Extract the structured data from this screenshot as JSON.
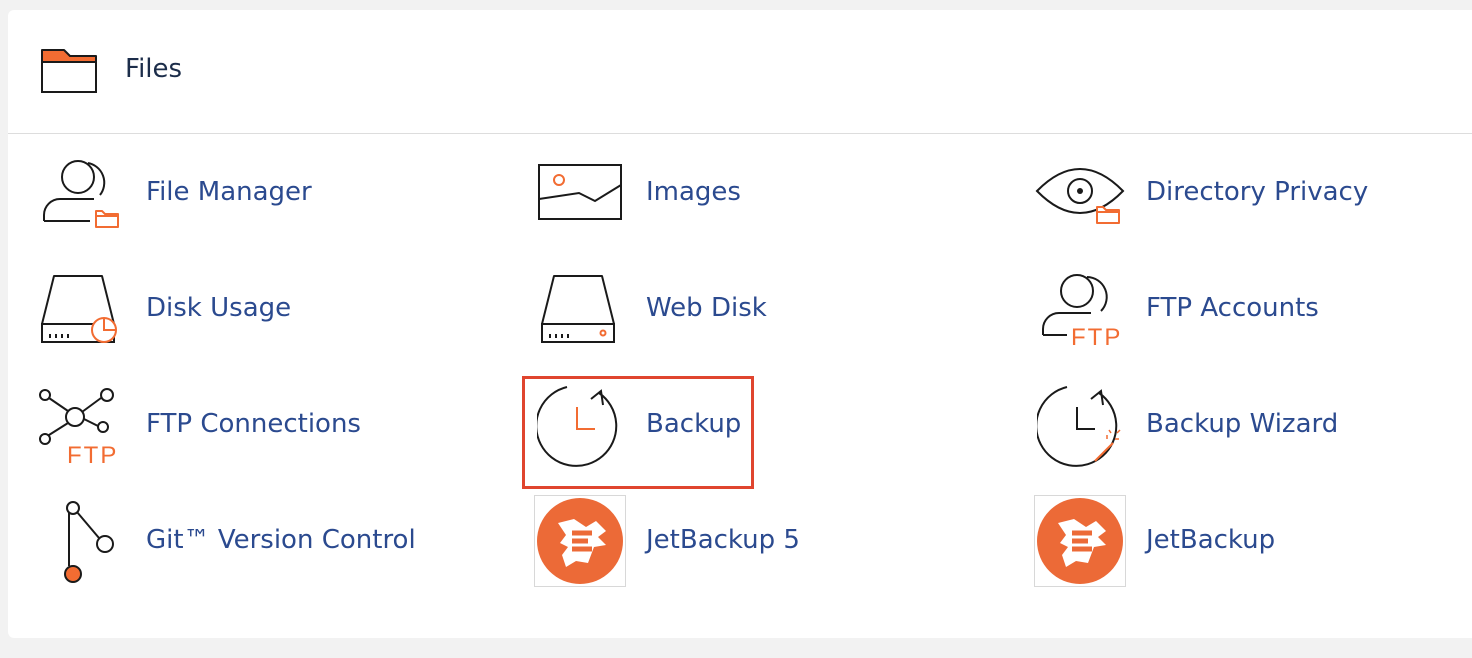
{
  "section": {
    "title": "Files",
    "icon": "folder-icon"
  },
  "items": [
    {
      "label": "File Manager",
      "icon": "file-manager-icon"
    },
    {
      "label": "Images",
      "icon": "images-icon"
    },
    {
      "label": "Directory Privacy",
      "icon": "directory-privacy-icon"
    },
    {
      "label": "Disk Usage",
      "icon": "disk-usage-icon"
    },
    {
      "label": "Web Disk",
      "icon": "web-disk-icon"
    },
    {
      "label": "FTP Accounts",
      "icon": "ftp-accounts-icon"
    },
    {
      "label": "FTP Connections",
      "icon": "ftp-connections-icon"
    },
    {
      "label": "Backup",
      "icon": "backup-icon",
      "highlighted": true
    },
    {
      "label": "Backup Wizard",
      "icon": "backup-wizard-icon"
    },
    {
      "label": "Git™ Version Control",
      "icon": "git-icon"
    },
    {
      "label": "JetBackup 5",
      "icon": "jetbackup-logo-icon"
    },
    {
      "label": "JetBackup",
      "icon": "jetbackup-logo-icon"
    }
  ],
  "icon_text": {
    "ftp": "FTP"
  },
  "colors": {
    "link": "#2b4a8f",
    "accent": "#f26c32",
    "highlight_border": "#e0452e",
    "icon_stroke": "#1a1a1a",
    "jetbackup_orange": "#ec6a37"
  }
}
